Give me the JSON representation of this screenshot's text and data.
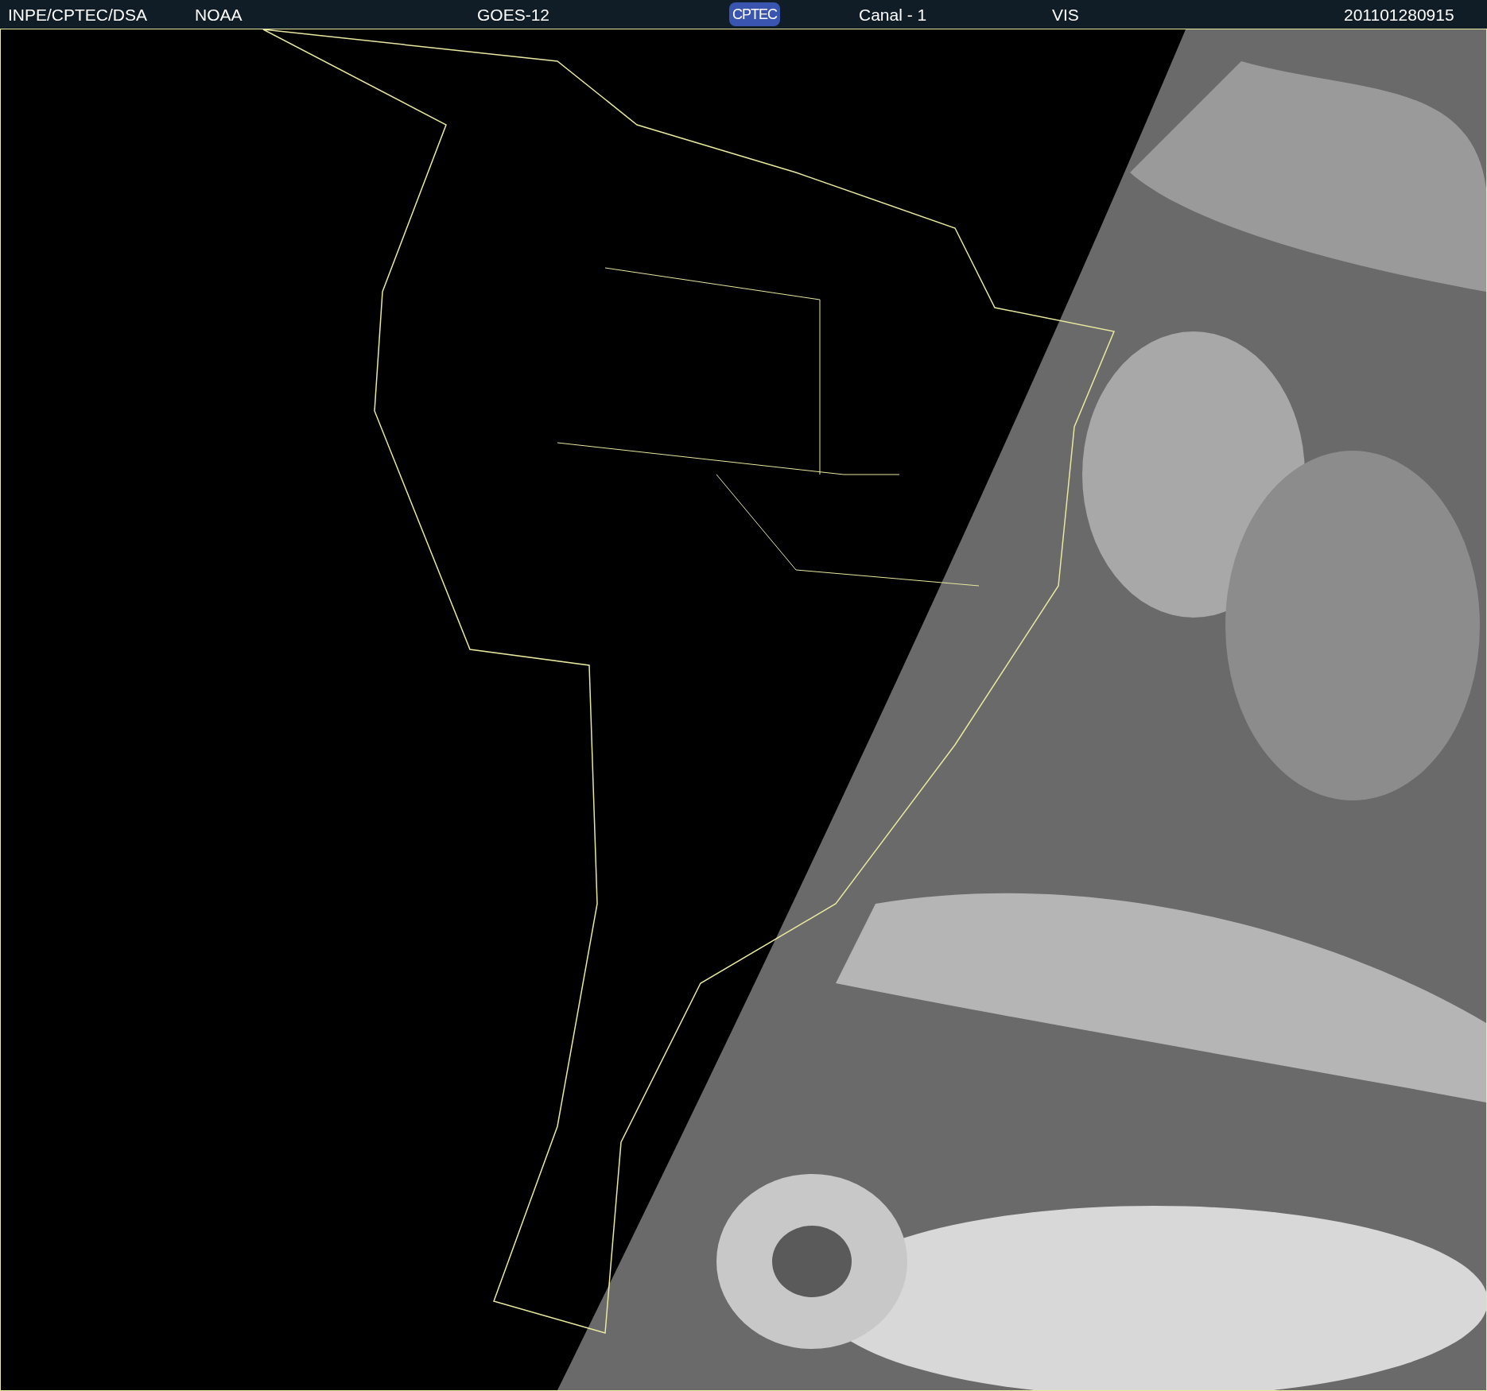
{
  "header": {
    "items": [
      {
        "kind": "text",
        "text": "INPE/CPTEC/DSA"
      },
      {
        "kind": "text",
        "text": "NOAA"
      },
      {
        "kind": "text",
        "text": "GOES-12"
      },
      {
        "kind": "logo",
        "text": "CPTEC"
      },
      {
        "kind": "text",
        "text": "Canal - 1"
      },
      {
        "kind": "text",
        "text": "VIS"
      },
      {
        "kind": "text",
        "text": "201101280915"
      }
    ]
  }
}
